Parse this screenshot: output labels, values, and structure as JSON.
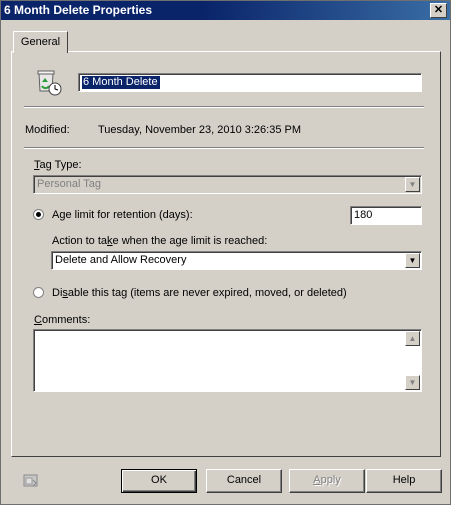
{
  "window": {
    "title": "6 Month Delete Properties",
    "close_glyph": "✕"
  },
  "tabs": [
    {
      "label": "General"
    }
  ],
  "tag": {
    "name": "6 Month Delete",
    "icon": "recycle-clock-icon"
  },
  "modified": {
    "label": "Modified:",
    "value": "Tuesday, November 23, 2010 3:26:35 PM"
  },
  "tag_type": {
    "label_prefix": "",
    "label_accel": "T",
    "label_rest": "ag Type:",
    "value": "Personal Tag"
  },
  "age_limit": {
    "label_a": "A",
    "label_accel": "g",
    "label_b": "e limit for retention (days):",
    "value": "180",
    "selected": true
  },
  "action": {
    "label_a": "Action to ta",
    "label_accel": "k",
    "label_b": "e when the age limit is reached:",
    "value": "Delete and Allow Recovery"
  },
  "disable": {
    "label_a": "Di",
    "label_accel": "s",
    "label_b": "able this tag (items are never expired, moved, or deleted)",
    "selected": false
  },
  "comments": {
    "label_accel": "C",
    "label_rest": "omments:",
    "value": ""
  },
  "buttons": {
    "ok": "OK",
    "cancel": "Cancel",
    "apply_accel": "A",
    "apply_rest": "pply",
    "help": "Help"
  },
  "colors": {
    "titlebar": "#0a246a",
    "face": "#d4d0c8",
    "selection": "#0a246a"
  }
}
